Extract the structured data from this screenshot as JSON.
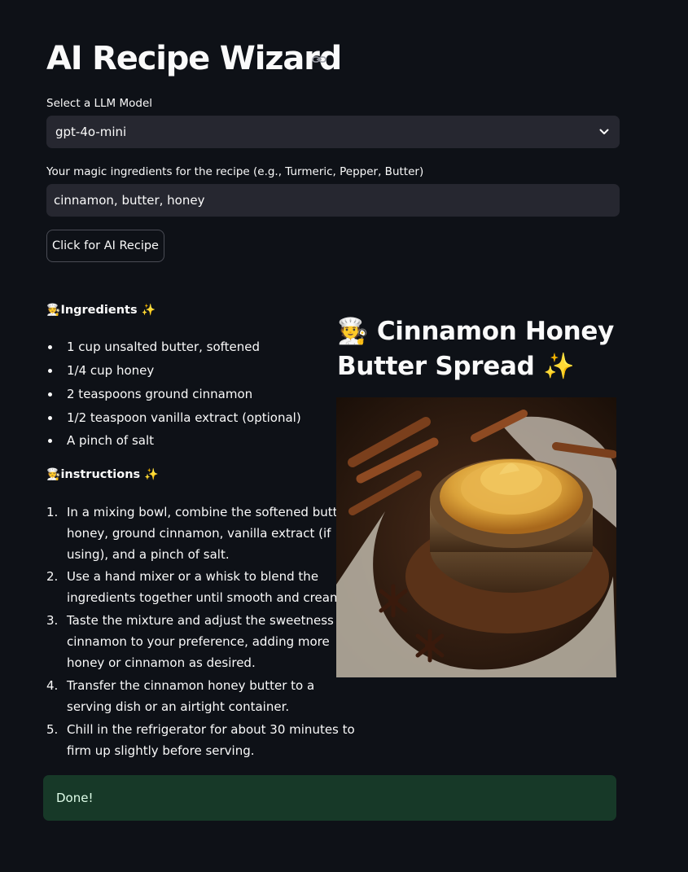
{
  "app": {
    "title": "AI Recipe Wizard"
  },
  "model_select": {
    "label": "Select a LLM Model",
    "value": "gpt-4o-mini"
  },
  "ingredients_input": {
    "label": "Your magic ingredients for the recipe (e.g., Turmeric, Pepper, Butter)",
    "value": "cinnamon, butter, honey"
  },
  "action_button": {
    "label": "Click for AI Recipe"
  },
  "recipe": {
    "ingredients_heading": "Ingredients",
    "ingredients": [
      "1 cup unsalted butter, softened",
      "1/4 cup honey",
      "2 teaspoons ground cinnamon",
      "1/2 teaspoon vanilla extract (optional)",
      "A pinch of salt"
    ],
    "instructions_heading": "instructions",
    "instructions": [
      [
        "In a mixing bowl, combine the softened butter,",
        "honey, ground cinnamon, vanilla extract (if",
        "using), and a pinch of salt."
      ],
      [
        "Use a hand mixer or a whisk to blend the",
        "ingredients together until smooth and creamy."
      ],
      [
        "Taste the mixture and adjust the sweetness or",
        "cinnamon to your preference, adding more",
        "honey or cinnamon as desired."
      ],
      [
        "Transfer the cinnamon honey butter to a",
        "serving dish or an airtight container."
      ],
      [
        "Chill in the refrigerator for about 30 minutes to",
        "firm up slightly before serving."
      ]
    ],
    "title_line1": "Cinnamon Honey",
    "title_line2": "Butter Spread",
    "chef_emoji": "🧑‍🍳",
    "sparkle_emoji": "✨"
  },
  "status": {
    "message": "Done!"
  },
  "colors": {
    "background": "#0e1117",
    "input_bg": "#262730",
    "success_bg": "#173928",
    "success_text": "#dffde9"
  }
}
